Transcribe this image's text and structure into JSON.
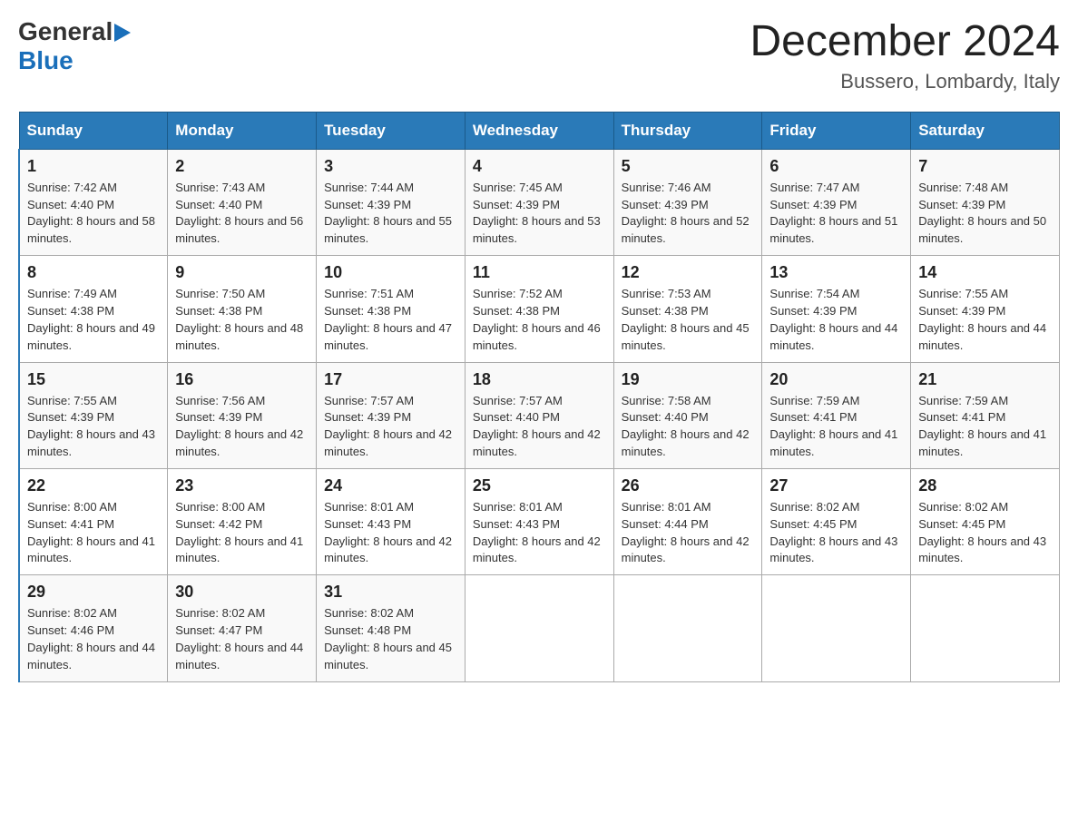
{
  "header": {
    "logo_line1": "General",
    "logo_arrow": "▶",
    "logo_line2": "Blue",
    "month_title": "December 2024",
    "location": "Bussero, Lombardy, Italy"
  },
  "weekdays": [
    "Sunday",
    "Monday",
    "Tuesday",
    "Wednesday",
    "Thursday",
    "Friday",
    "Saturday"
  ],
  "weeks": [
    [
      {
        "day": "1",
        "sunrise": "7:42 AM",
        "sunset": "4:40 PM",
        "daylight": "8 hours and 58 minutes."
      },
      {
        "day": "2",
        "sunrise": "7:43 AM",
        "sunset": "4:40 PM",
        "daylight": "8 hours and 56 minutes."
      },
      {
        "day": "3",
        "sunrise": "7:44 AM",
        "sunset": "4:39 PM",
        "daylight": "8 hours and 55 minutes."
      },
      {
        "day": "4",
        "sunrise": "7:45 AM",
        "sunset": "4:39 PM",
        "daylight": "8 hours and 53 minutes."
      },
      {
        "day": "5",
        "sunrise": "7:46 AM",
        "sunset": "4:39 PM",
        "daylight": "8 hours and 52 minutes."
      },
      {
        "day": "6",
        "sunrise": "7:47 AM",
        "sunset": "4:39 PM",
        "daylight": "8 hours and 51 minutes."
      },
      {
        "day": "7",
        "sunrise": "7:48 AM",
        "sunset": "4:39 PM",
        "daylight": "8 hours and 50 minutes."
      }
    ],
    [
      {
        "day": "8",
        "sunrise": "7:49 AM",
        "sunset": "4:38 PM",
        "daylight": "8 hours and 49 minutes."
      },
      {
        "day": "9",
        "sunrise": "7:50 AM",
        "sunset": "4:38 PM",
        "daylight": "8 hours and 48 minutes."
      },
      {
        "day": "10",
        "sunrise": "7:51 AM",
        "sunset": "4:38 PM",
        "daylight": "8 hours and 47 minutes."
      },
      {
        "day": "11",
        "sunrise": "7:52 AM",
        "sunset": "4:38 PM",
        "daylight": "8 hours and 46 minutes."
      },
      {
        "day": "12",
        "sunrise": "7:53 AM",
        "sunset": "4:38 PM",
        "daylight": "8 hours and 45 minutes."
      },
      {
        "day": "13",
        "sunrise": "7:54 AM",
        "sunset": "4:39 PM",
        "daylight": "8 hours and 44 minutes."
      },
      {
        "day": "14",
        "sunrise": "7:55 AM",
        "sunset": "4:39 PM",
        "daylight": "8 hours and 44 minutes."
      }
    ],
    [
      {
        "day": "15",
        "sunrise": "7:55 AM",
        "sunset": "4:39 PM",
        "daylight": "8 hours and 43 minutes."
      },
      {
        "day": "16",
        "sunrise": "7:56 AM",
        "sunset": "4:39 PM",
        "daylight": "8 hours and 42 minutes."
      },
      {
        "day": "17",
        "sunrise": "7:57 AM",
        "sunset": "4:39 PM",
        "daylight": "8 hours and 42 minutes."
      },
      {
        "day": "18",
        "sunrise": "7:57 AM",
        "sunset": "4:40 PM",
        "daylight": "8 hours and 42 minutes."
      },
      {
        "day": "19",
        "sunrise": "7:58 AM",
        "sunset": "4:40 PM",
        "daylight": "8 hours and 42 minutes."
      },
      {
        "day": "20",
        "sunrise": "7:59 AM",
        "sunset": "4:41 PM",
        "daylight": "8 hours and 41 minutes."
      },
      {
        "day": "21",
        "sunrise": "7:59 AM",
        "sunset": "4:41 PM",
        "daylight": "8 hours and 41 minutes."
      }
    ],
    [
      {
        "day": "22",
        "sunrise": "8:00 AM",
        "sunset": "4:41 PM",
        "daylight": "8 hours and 41 minutes."
      },
      {
        "day": "23",
        "sunrise": "8:00 AM",
        "sunset": "4:42 PM",
        "daylight": "8 hours and 41 minutes."
      },
      {
        "day": "24",
        "sunrise": "8:01 AM",
        "sunset": "4:43 PM",
        "daylight": "8 hours and 42 minutes."
      },
      {
        "day": "25",
        "sunrise": "8:01 AM",
        "sunset": "4:43 PM",
        "daylight": "8 hours and 42 minutes."
      },
      {
        "day": "26",
        "sunrise": "8:01 AM",
        "sunset": "4:44 PM",
        "daylight": "8 hours and 42 minutes."
      },
      {
        "day": "27",
        "sunrise": "8:02 AM",
        "sunset": "4:45 PM",
        "daylight": "8 hours and 43 minutes."
      },
      {
        "day": "28",
        "sunrise": "8:02 AM",
        "sunset": "4:45 PM",
        "daylight": "8 hours and 43 minutes."
      }
    ],
    [
      {
        "day": "29",
        "sunrise": "8:02 AM",
        "sunset": "4:46 PM",
        "daylight": "8 hours and 44 minutes."
      },
      {
        "day": "30",
        "sunrise": "8:02 AM",
        "sunset": "4:47 PM",
        "daylight": "8 hours and 44 minutes."
      },
      {
        "day": "31",
        "sunrise": "8:02 AM",
        "sunset": "4:48 PM",
        "daylight": "8 hours and 45 minutes."
      },
      null,
      null,
      null,
      null
    ]
  ]
}
